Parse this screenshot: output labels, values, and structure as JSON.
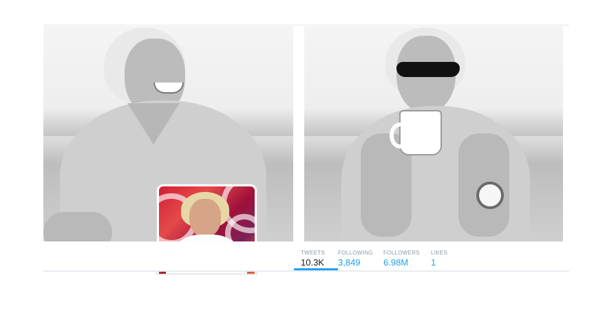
{
  "profile_nav": {
    "tweets": {
      "label": "TWEETS",
      "value": "10.3K"
    },
    "following": {
      "label": "FOLLOWING",
      "value": "3,849"
    },
    "followers": {
      "label": "FOLLOWERS",
      "value": "6.98M"
    },
    "likes": {
      "label": "LIKES",
      "value": "1"
    }
  },
  "colors": {
    "accent": "#1da1f2",
    "label_gray": "#8899a6",
    "active_value": "#14171a"
  }
}
